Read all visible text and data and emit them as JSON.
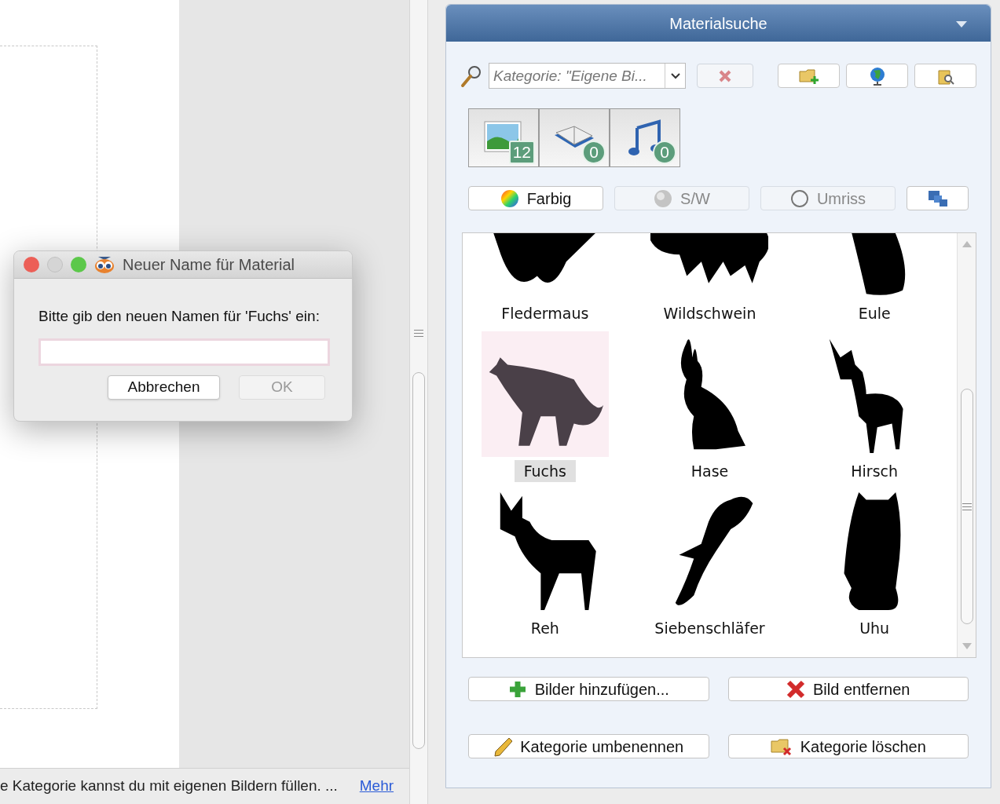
{
  "left_pane": {
    "status_text": "e Kategorie kannst du mit eigenen Bildern füllen. ...",
    "status_link": "Mehr"
  },
  "dialog": {
    "title": "Neuer Name für Material",
    "prompt": "Bitte gib den neuen Namen für 'Fuchs' ein:",
    "buttons": [
      {
        "label": "Abbrechen",
        "disabled": false
      },
      {
        "label": "OK",
        "disabled": true
      }
    ]
  },
  "panel": {
    "title": "Materialsuche",
    "search": {
      "value": "Kategorie: \"Eigene Bi..."
    },
    "media_tabs": [
      {
        "kind": "image",
        "count": "12",
        "selected": true
      },
      {
        "kind": "book",
        "count": "0",
        "selected": true
      },
      {
        "kind": "music",
        "count": "0",
        "selected": true
      }
    ],
    "color_filters": [
      {
        "kind": "color",
        "label": "Farbig",
        "selected": true
      },
      {
        "kind": "bw",
        "label": "S/W",
        "selected": false
      },
      {
        "kind": "outline",
        "label": "Umriss",
        "selected": false
      }
    ],
    "items": [
      {
        "label": "Fledermaus",
        "selected": false
      },
      {
        "label": "Wildschwein",
        "selected": false
      },
      {
        "label": "Eule",
        "selected": false
      },
      {
        "label": "Fuchs",
        "selected": true
      },
      {
        "label": "Hase",
        "selected": false
      },
      {
        "label": "Hirsch",
        "selected": false
      },
      {
        "label": "Reh",
        "selected": false
      },
      {
        "label": "Siebenschläfer",
        "selected": false
      },
      {
        "label": "Uhu",
        "selected": false
      }
    ],
    "actions": [
      {
        "kind": "add",
        "label": "Bilder hinzufügen..."
      },
      {
        "kind": "remove",
        "label": "Bild entfernen"
      },
      {
        "kind": "rename",
        "label": "Kategorie umbenennen"
      },
      {
        "kind": "delete",
        "label": "Kategorie löschen"
      }
    ]
  }
}
